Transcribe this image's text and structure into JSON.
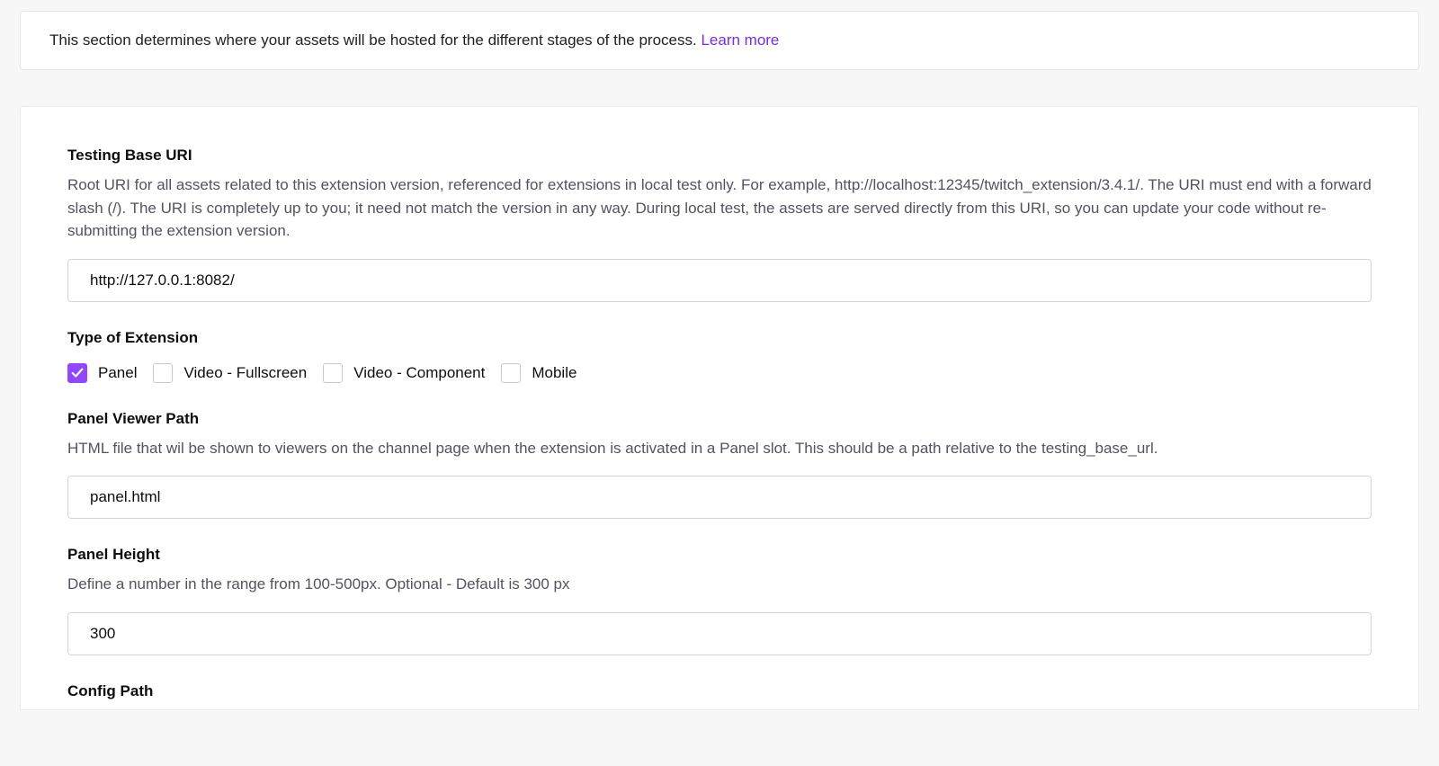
{
  "banner": {
    "text": "This section determines where your assets will be hosted for the different stages of the process. ",
    "learn_more": "Learn more"
  },
  "form": {
    "testing_base_uri": {
      "label": "Testing Base URI",
      "desc": "Root URI for all assets related to this extension version, referenced for extensions in local test only. For example, http://localhost:12345/twitch_extension/3.4.1/. The URI must end with a forward slash (/). The URI is completely up to you; it need not match the version in any way. During local test, the assets are served directly from this URI, so you can update your code without re-submitting the extension version.",
      "value": "http://127.0.0.1:8082/"
    },
    "type_of_extension": {
      "label": "Type of Extension",
      "options": [
        {
          "label": "Panel",
          "checked": true
        },
        {
          "label": "Video - Fullscreen",
          "checked": false
        },
        {
          "label": "Video - Component",
          "checked": false
        },
        {
          "label": "Mobile",
          "checked": false
        }
      ]
    },
    "panel_viewer_path": {
      "label": "Panel Viewer Path",
      "desc": "HTML file that wil be shown to viewers on the channel page when the extension is activated in a Panel slot. This should be a path relative to the testing_base_url.",
      "value": "panel.html"
    },
    "panel_height": {
      "label": "Panel Height",
      "desc": "Define a number in the range from 100-500px. Optional - Default is 300 px",
      "value": "300"
    },
    "config_path": {
      "label": "Config Path"
    }
  }
}
